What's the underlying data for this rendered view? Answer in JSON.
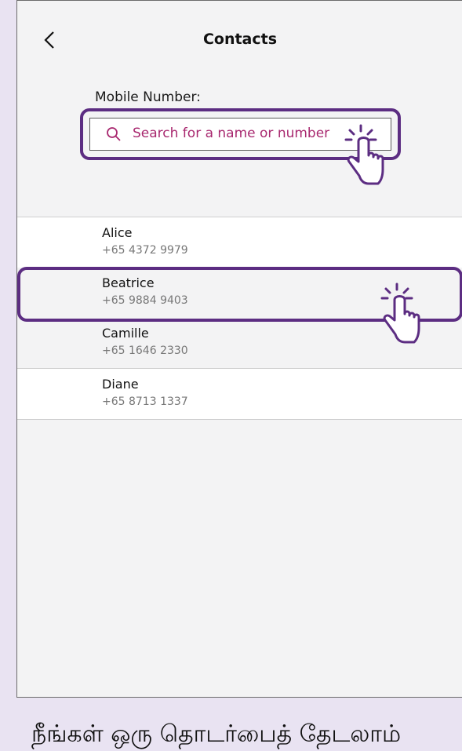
{
  "header": {
    "title": "Contacts",
    "back_icon": "chevron-left-icon"
  },
  "search": {
    "label": "Mobile Number:",
    "placeholder": "Search for a name or number",
    "icon": "search-icon"
  },
  "contacts": [
    {
      "name": "Alice",
      "phone": "+65 4372 9979"
    },
    {
      "name": "Beatrice",
      "phone": "+65 9884 9403"
    },
    {
      "name": "Camille",
      "phone": "+65 1646 2330"
    },
    {
      "name": "Diane",
      "phone": "+65 8713 1337"
    }
  ],
  "caption": "நீங்கள் ஒரு தொடர்பைத் தேடலாம்",
  "colors": {
    "accent": "#5c2d82",
    "placeholder": "#a8286f",
    "background": "#e9e3f2"
  }
}
